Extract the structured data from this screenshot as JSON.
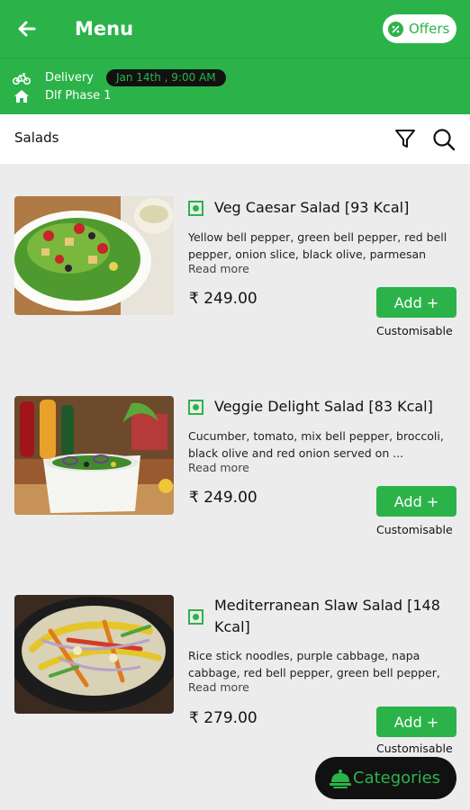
{
  "header": {
    "title": "Menu",
    "offers_label": "Offers"
  },
  "delivery": {
    "mode_label": "Delivery",
    "date_time": "Jan 14th , 9:00 AM",
    "location": "Dlf Phase 1"
  },
  "section": {
    "title": "Salads"
  },
  "items": [
    {
      "name": "Veg Caesar Salad [93 Kcal]",
      "description": "Yellow bell pepper, green bell pepper, red bell pepper, onion slice, black olive, parmesan ch...",
      "read_more": "Read more",
      "price": "₹ 249.00",
      "add_label": "Add +",
      "customisable": "Customisable"
    },
    {
      "name": "Veggie Delight Salad [83 Kcal]",
      "description": "Cucumber, tomato, mix bell pepper, broccoli, black olive and red onion served on ...",
      "read_more": "Read more",
      "price": "₹ 249.00",
      "add_label": "Add +",
      "customisable": "Customisable"
    },
    {
      "name": "Mediterranean Slaw Salad [148 Kcal]",
      "description": "Rice stick noodles, purple cabbage, napa cabbage, red bell pepper, green bell pepper, ...",
      "read_more": "Read more",
      "price": "₹ 279.00",
      "add_label": "Add +",
      "customisable": "Customisable"
    }
  ],
  "categories_label": "Categories",
  "colors": {
    "brand_green": "#2bb34a",
    "background": "#ececec",
    "dark": "#111111"
  }
}
